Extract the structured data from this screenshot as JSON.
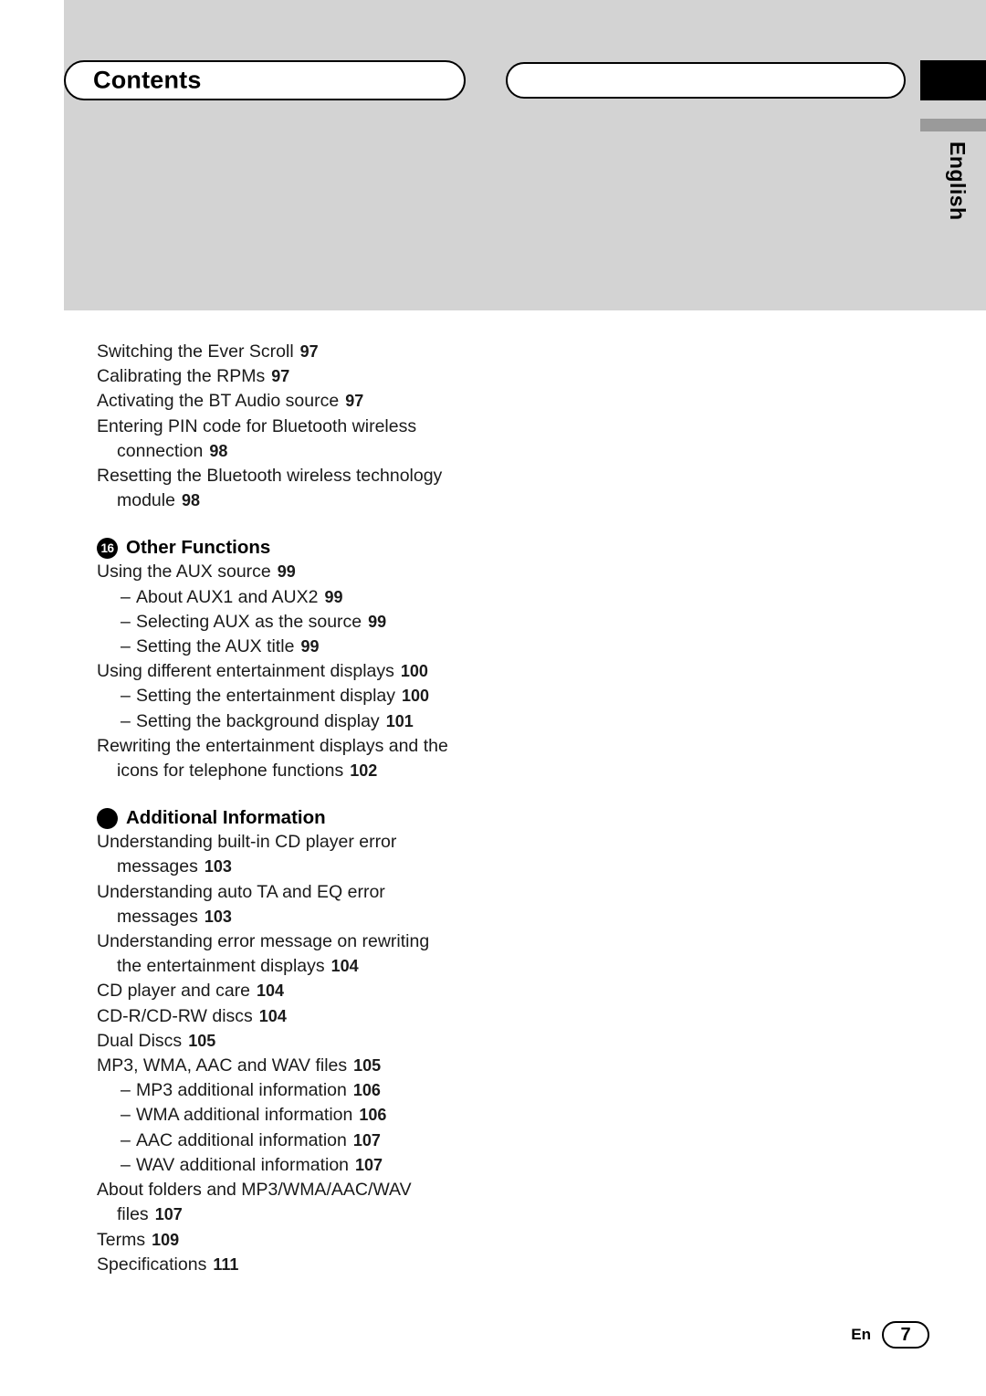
{
  "header": {
    "title": "Contents",
    "language_tab": "English"
  },
  "footer": {
    "locale": "En",
    "page": "7"
  },
  "toc": {
    "top_entries": [
      {
        "text": "Switching the Ever Scroll",
        "page": "97",
        "indent": 0
      },
      {
        "text": "Calibrating the RPMs",
        "page": "97",
        "indent": 0
      },
      {
        "text": "Activating the BT Audio source",
        "page": "97",
        "indent": 0
      },
      {
        "text": "Entering PIN code for Bluetooth wireless",
        "page": "",
        "indent": 0
      },
      {
        "text": "connection",
        "page": "98",
        "indent": 2
      },
      {
        "text": "Resetting the Bluetooth wireless technology",
        "page": "",
        "indent": 0
      },
      {
        "text": "module",
        "page": "98",
        "indent": 2
      }
    ],
    "sections": [
      {
        "badge": "16",
        "title": "Other Functions",
        "entries": [
          {
            "text": "Using the AUX source",
            "page": "99",
            "indent": 0,
            "dash": false
          },
          {
            "text": "About AUX1 and AUX2",
            "page": "99",
            "indent": 1,
            "dash": true
          },
          {
            "text": "Selecting AUX as the source",
            "page": "99",
            "indent": 1,
            "dash": true
          },
          {
            "text": "Setting the AUX title",
            "page": "99",
            "indent": 1,
            "dash": true
          },
          {
            "text": "Using different entertainment displays",
            "page": "100",
            "indent": 0,
            "dash": false
          },
          {
            "text": "Setting the entertainment display",
            "page": "100",
            "indent": 1,
            "dash": true
          },
          {
            "text": "Setting the background display",
            "page": "101",
            "indent": 1,
            "dash": true
          },
          {
            "text": "Rewriting the entertainment displays and the",
            "page": "",
            "indent": 0,
            "dash": false
          },
          {
            "text": "icons for telephone functions",
            "page": "102",
            "indent": 2,
            "dash": false
          }
        ]
      },
      {
        "badge": "",
        "title": "Additional Information",
        "entries": [
          {
            "text": "Understanding built-in CD player error",
            "page": "",
            "indent": 0,
            "dash": false
          },
          {
            "text": "messages",
            "page": "103",
            "indent": 2,
            "dash": false
          },
          {
            "text": "Understanding auto TA and EQ error",
            "page": "",
            "indent": 0,
            "dash": false
          },
          {
            "text": "messages",
            "page": "103",
            "indent": 2,
            "dash": false
          },
          {
            "text": "Understanding error message on rewriting",
            "page": "",
            "indent": 0,
            "dash": false
          },
          {
            "text": "the entertainment displays",
            "page": "104",
            "indent": 2,
            "dash": false
          },
          {
            "text": "CD player and care",
            "page": "104",
            "indent": 0,
            "dash": false
          },
          {
            "text": "CD-R/CD-RW discs",
            "page": "104",
            "indent": 0,
            "dash": false
          },
          {
            "text": "Dual Discs",
            "page": "105",
            "indent": 0,
            "dash": false
          },
          {
            "text": "MP3, WMA, AAC and WAV files",
            "page": "105",
            "indent": 0,
            "dash": false
          },
          {
            "text": "MP3 additional information",
            "page": "106",
            "indent": 1,
            "dash": true
          },
          {
            "text": "WMA additional information",
            "page": "106",
            "indent": 1,
            "dash": true
          },
          {
            "text": "AAC additional information",
            "page": "107",
            "indent": 1,
            "dash": true
          },
          {
            "text": "WAV additional information",
            "page": "107",
            "indent": 1,
            "dash": true
          },
          {
            "text": "About folders and MP3/WMA/AAC/WAV",
            "page": "",
            "indent": 0,
            "dash": false
          },
          {
            "text": "files",
            "page": "107",
            "indent": 2,
            "dash": false
          },
          {
            "text": "Terms",
            "page": "109",
            "indent": 0,
            "dash": false
          },
          {
            "text": "Specifications",
            "page": "111",
            "indent": 0,
            "dash": false
          }
        ]
      }
    ]
  }
}
